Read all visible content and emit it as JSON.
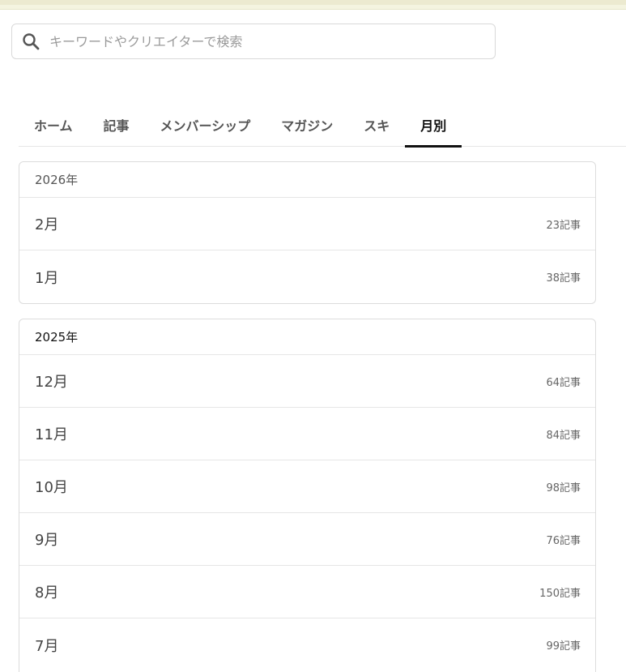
{
  "search": {
    "placeholder": "キーワードやクリエイターで検索"
  },
  "tabs": [
    {
      "label": "ホーム"
    },
    {
      "label": "記事"
    },
    {
      "label": "メンバーシップ"
    },
    {
      "label": "マガジン"
    },
    {
      "label": "スキ"
    },
    {
      "label": "月別"
    }
  ],
  "active_tab": "月別",
  "years": [
    {
      "year": "2026年",
      "months": [
        {
          "month": "2月",
          "count": "23記事"
        },
        {
          "month": "1月",
          "count": "38記事"
        }
      ]
    },
    {
      "year": "2025年",
      "months": [
        {
          "month": "12月",
          "count": "64記事"
        },
        {
          "month": "11月",
          "count": "84記事"
        },
        {
          "month": "10月",
          "count": "98記事"
        },
        {
          "month": "9月",
          "count": "76記事"
        },
        {
          "month": "8月",
          "count": "150記事"
        },
        {
          "month": "7月",
          "count": "99記事"
        }
      ]
    }
  ],
  "icons": {
    "search": "search-icon"
  },
  "colors": {
    "active_tab_underline": "#111111",
    "banner": "#f4f4e0"
  }
}
